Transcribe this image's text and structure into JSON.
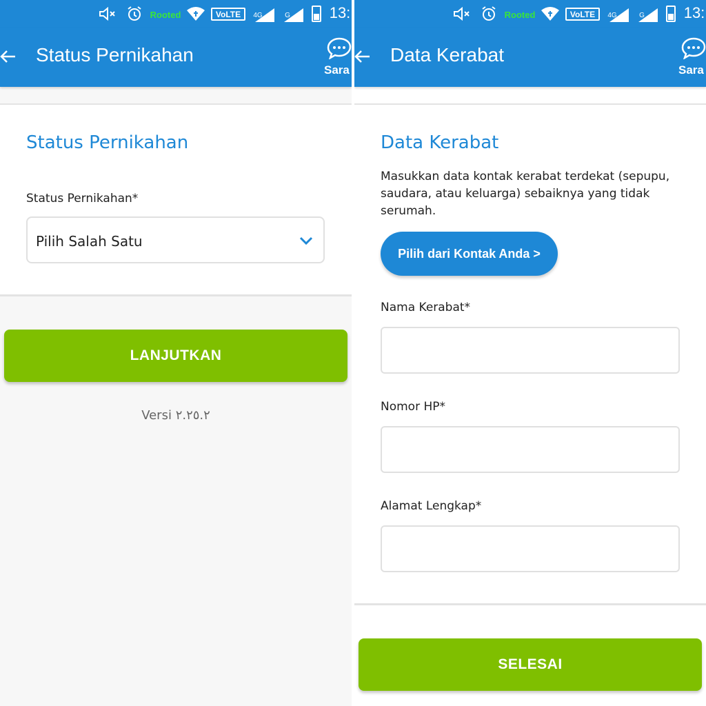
{
  "status_bar": {
    "rooted_label": "Rooted",
    "volte_label": "VoLTE",
    "network_4g": "4G",
    "network_g": "G",
    "time": "13:"
  },
  "left": {
    "app_bar": {
      "title": "Status Pernikahan",
      "chat_label": "Sara"
    },
    "section_title": "Status Pernikahan",
    "field_label": "Status Pernikahan*",
    "select_value": "Pilih Salah Satu",
    "primary_button": "LANJUTKAN",
    "version": "Versi ٢.٢٥.٢"
  },
  "right": {
    "app_bar": {
      "title": "Data Kerabat",
      "chat_label": "Sara"
    },
    "section_title": "Data Kerabat",
    "description": "Masukkan data kontak kerabat terdekat (sepupu, saudara, atau keluarga) sebaiknya yang tidak serumah.",
    "contact_button": "Pilih dari Kontak Anda >",
    "fields": [
      {
        "label": "Nama Kerabat*",
        "value": ""
      },
      {
        "label": "Nomor HP*",
        "value": ""
      },
      {
        "label": "Alamat Lengkap*",
        "value": ""
      }
    ],
    "primary_button": "SELESAI"
  },
  "colors": {
    "primary_blue": "#1e88d6",
    "action_green": "#7fbf00",
    "rooted_green": "#39e639"
  }
}
